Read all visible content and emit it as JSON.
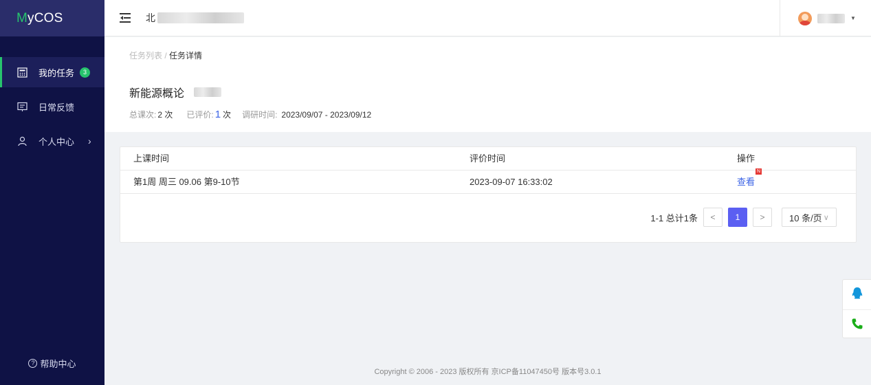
{
  "app": {
    "logo_m": "M",
    "logo_rest": "yCOS"
  },
  "sidebar": {
    "items": [
      {
        "label": "我的任务",
        "badge": "3",
        "icon": "calculator-icon"
      },
      {
        "label": "日常反馈",
        "icon": "feedback-icon"
      },
      {
        "label": "个人中心",
        "icon": "user-icon"
      }
    ],
    "help_label": "帮助中心",
    "accent_color": "#27c46d",
    "background": "#0f1245"
  },
  "header": {
    "school_prefix": "北"
  },
  "breadcrumb": {
    "parent": "任务列表",
    "separator": " / ",
    "current": "任务详情"
  },
  "course": {
    "title": "新能源概论",
    "total_label": "总课次:",
    "total_value": "2 次",
    "evaluated_label": "已评价:",
    "evaluated_value": "1",
    "evaluated_unit": "次",
    "survey_label": "调研时间:",
    "survey_value": "2023/09/07 - 2023/09/12"
  },
  "table": {
    "columns": [
      "上课时间",
      "评价时间",
      "操作"
    ],
    "rows": [
      {
        "class_time": "第1周 周三 09.06 第9-10节",
        "eval_time": "2023-09-07 16:33:02",
        "action": "查看",
        "tag": "N"
      }
    ]
  },
  "pagination": {
    "summary": "1-1 总计1条",
    "prev": "<",
    "current_page": "1",
    "next": ">",
    "page_size": "10 条/页"
  },
  "footer": {
    "text": "Copyright © 2006 - 2023 版权所有 京ICP备11047450号 版本号3.0.1"
  }
}
